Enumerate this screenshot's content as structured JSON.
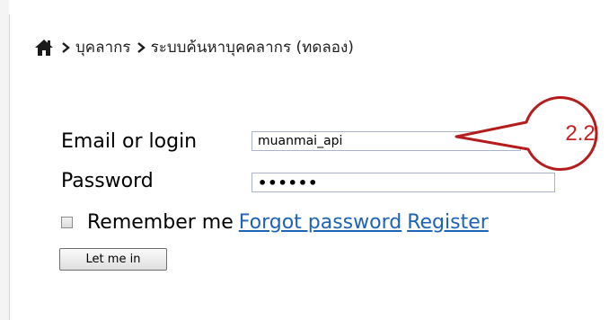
{
  "breadcrumb": {
    "home_icon": "home-icon",
    "separator_icon": "chevron-right-icon",
    "items": [
      {
        "label": "บุคลากร"
      },
      {
        "label": "ระบบค้นหาบุคคลากร (ทดลอง)"
      }
    ]
  },
  "login_form": {
    "email_label": "Email or login",
    "email_value": "muanmai_api",
    "password_label": "Password",
    "password_value": "••••••",
    "remember_label": "Remember me",
    "forgot_password_link": "Forgot password",
    "register_link": "Register",
    "submit_label": "Let me in"
  },
  "annotation": {
    "label": "2.2",
    "color": "#cc1f1f"
  }
}
